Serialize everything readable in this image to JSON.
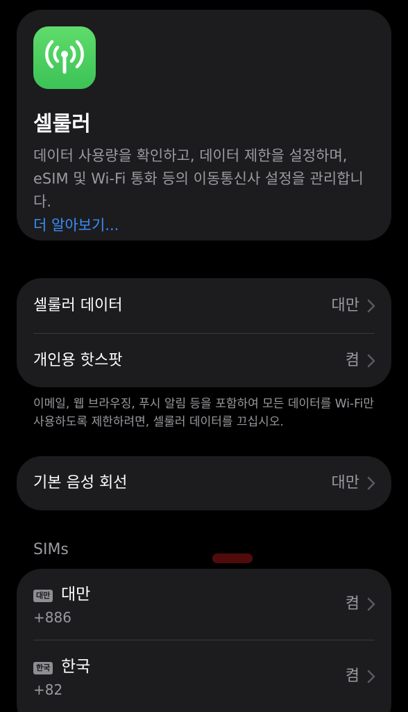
{
  "header": {
    "icon": "cellular-antenna-icon",
    "icon_color": "#4cd964",
    "title": "셀룰러",
    "description": "데이터 사용량을 확인하고, 데이터 제한을 설정하며, eSIM 및 Wi-Fi 통화 등의 이동통신사 설정을 관리합니다.",
    "learn_more": "더 알아보기..."
  },
  "cellular_rows": [
    {
      "label": "셀룰러 데이터",
      "value": "대만"
    },
    {
      "label": "개인용 핫스팟",
      "value": "켬"
    }
  ],
  "cellular_footer": "이메일, 웹 브라우징, 푸시 알림 등을 포함하여 모든 데이터를 Wi-Fi만 사용하도록 제한하려면, 셀룰러 데이터를 끄십시오.",
  "voice": {
    "label": "기본 음성 회선",
    "value": "대만"
  },
  "sims": {
    "header": "SIMs",
    "items": [
      {
        "badge": "대만",
        "name": "대만",
        "number": "+886",
        "value": "켬"
      },
      {
        "badge": "한국",
        "name": "한국",
        "number": "+82",
        "value": "켬"
      }
    ]
  },
  "colors": {
    "background": "#000000",
    "card": "#1c1c1e",
    "secondary_text": "#9a9aa0",
    "link": "#3b8cf6",
    "accent_green": "#4cd964"
  }
}
